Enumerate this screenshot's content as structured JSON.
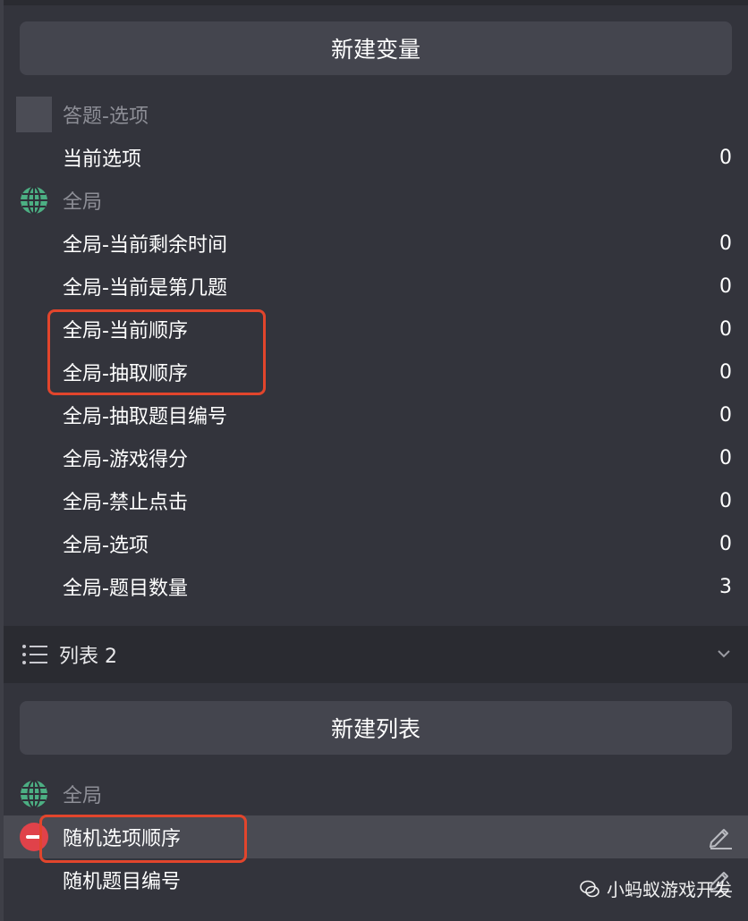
{
  "variables_panel": {
    "new_variable_button": "新建变量",
    "groups": [
      {
        "label": "答题-选项",
        "icon": "gray-square",
        "items": [
          {
            "name": "当前选项",
            "value": "0"
          }
        ]
      },
      {
        "label": "全局",
        "icon": "globe-icon",
        "items": [
          {
            "name": "全局-当前剩余时间",
            "value": "0"
          },
          {
            "name": "全局-当前是第几题",
            "value": "0"
          },
          {
            "name": "全局-当前顺序",
            "value": "0"
          },
          {
            "name": "全局-抽取顺序",
            "value": "0"
          },
          {
            "name": "全局-抽取题目编号",
            "value": "0"
          },
          {
            "name": "全局-游戏得分",
            "value": "0"
          },
          {
            "name": "全局-禁止点击",
            "value": "0"
          },
          {
            "name": "全局-选项",
            "value": "0"
          },
          {
            "name": "全局-题目数量",
            "value": "3"
          }
        ]
      }
    ]
  },
  "lists_section": {
    "header_title": "列表 2",
    "icon": "list-icon",
    "expanded_icon": "chevron-down-icon",
    "new_list_button": "新建列表",
    "group_label": "全局",
    "items": [
      {
        "name": "随机选项顺序",
        "selected": true
      },
      {
        "name": "随机题目编号",
        "selected": false
      }
    ]
  },
  "watermark": {
    "text": "小蚂蚁游戏开发"
  },
  "colors": {
    "panel_bg": "#33343c",
    "button_bg": "#44454e",
    "header_bg": "#2a2b31",
    "selected_row_bg": "#4a4b53",
    "muted_text": "#8d8e96",
    "remove_red": "#e0424a",
    "highlight_red": "#e2452c",
    "globe_green": "#4caf83"
  }
}
